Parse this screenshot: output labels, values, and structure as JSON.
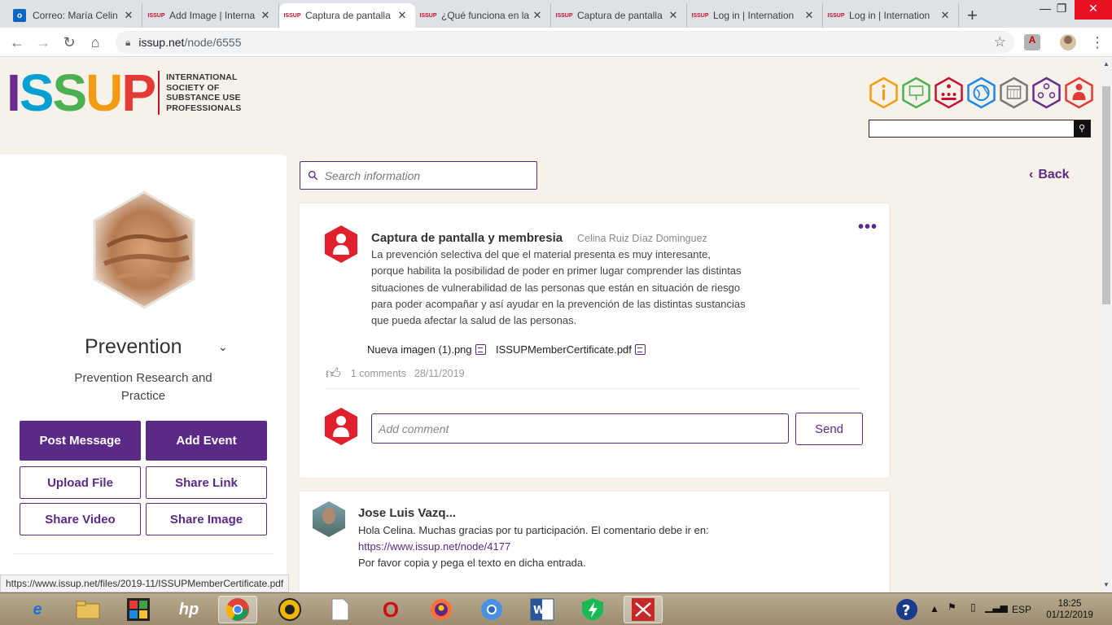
{
  "browser": {
    "tabs": [
      {
        "label": "Correo: María Celin",
        "favicon": "outlook-icon",
        "active": false
      },
      {
        "label": "Add Image | Interna",
        "favicon": "issup-icon",
        "active": false
      },
      {
        "label": "Captura de pantalla",
        "favicon": "issup-icon",
        "active": true
      },
      {
        "label": "¿Qué funciona en la",
        "favicon": "issup-icon",
        "active": false
      },
      {
        "label": "Captura de pantalla",
        "favicon": "issup-icon",
        "active": false
      },
      {
        "label": "Log in | Internation",
        "favicon": "issup-icon",
        "active": false
      },
      {
        "label": "Log in | Internation",
        "favicon": "issup-icon",
        "active": false
      }
    ],
    "url_host": "issup.net",
    "url_path": "/node/6555",
    "status_url": "https://www.issup.net/files/2019-11/ISSUPMemberCertificate.pdf"
  },
  "header": {
    "logo_letters": [
      "I",
      "S",
      "S",
      "U",
      "P"
    ],
    "logo_lines": [
      "INTERNATIONAL",
      "SOCIETY OF",
      "SUBSTANCE USE",
      "PROFESSIONALS"
    ],
    "nav_icons": [
      {
        "name": "info-icon",
        "color": "#f39c12"
      },
      {
        "name": "presentation-icon",
        "color": "#4caf50"
      },
      {
        "name": "network-icon",
        "color": "#c8102e"
      },
      {
        "name": "globe-icon",
        "color": "#1e88e5"
      },
      {
        "name": "calendar-icon",
        "color": "#777777"
      },
      {
        "name": "people-icon",
        "color": "#6a2c8e"
      },
      {
        "name": "profile-icon",
        "color": "#e53935"
      }
    ]
  },
  "sidebar": {
    "group_title": "Prevention",
    "group_subtitle_line1": "Prevention Research and",
    "group_subtitle_line2": "Practice",
    "buttons": {
      "post_message": "Post Message",
      "add_event": "Add Event",
      "upload_file": "Upload File",
      "share_link": "Share Link",
      "share_video": "Share Video",
      "share_image": "Share Image"
    }
  },
  "main": {
    "search_placeholder": "Search information",
    "back_label": "Back",
    "post": {
      "title": "Captura de pantalla y membresia",
      "author": "Celina Ruiz Díaz Dominguez",
      "body_lines": [
        "La prevención selectiva del que el material presenta es muy interesante,",
        "porque habilita la posibilidad de poder en primer lugar comprender las distintas",
        "situaciones de vulnerabilidad de las personas que están en situación de riesgo",
        "para poder acompañar y así ayudar en la prevención de las distintas sustancias",
        "que pueda afectar la salud de las personas."
      ],
      "attachments": [
        "Nueva imagen (1).png",
        "ISSUPMemberCertificate.pdf"
      ],
      "comments_count": "1 comments",
      "date": "28/11/2019",
      "comment_placeholder": "Add comment",
      "send_label": "Send"
    },
    "reply": {
      "author": "Jose Luis Vazq...",
      "line1": "Hola Celina. Muchas gracias por tu participación. El comentario debe ir en:",
      "link": "https://www.issup.net/node/4177",
      "line3": "Por favor copia y pega el texto en dicha entrada."
    }
  },
  "taskbar": {
    "language": "ESP",
    "time": "18:25",
    "date": "01/12/2019"
  }
}
